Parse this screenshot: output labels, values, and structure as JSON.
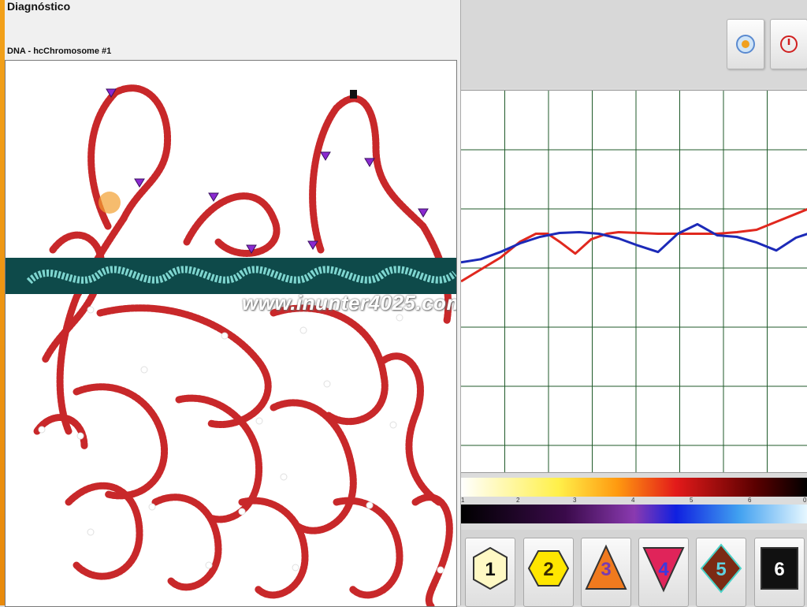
{
  "window": {
    "title": "Diagnóstico",
    "subtitle": "DNA - hcChromosome #1"
  },
  "watermark": "www.inunter4025.com",
  "toolbar": {
    "buttons": [
      {
        "name": "record-button",
        "icon": "record-icon"
      },
      {
        "name": "power-button",
        "icon": "power-icon"
      }
    ]
  },
  "colors": {
    "red_curve": "#e0281e",
    "blue_curve": "#1c2ab8",
    "grid": "#1f5a2a",
    "band": "#0e4a4a"
  },
  "chart_data": {
    "type": "line",
    "xlim": [
      0,
      440
    ],
    "ylim": [
      0,
      480
    ],
    "grid": true,
    "series": [
      {
        "x": [
          0,
          25,
          50,
          75,
          95,
          110,
          125,
          145,
          165,
          185,
          200,
          225,
          250,
          275,
          300,
          325,
          350,
          375,
          400,
          425,
          440
        ],
        "y": [
          240,
          255,
          270,
          290,
          300,
          300,
          290,
          275,
          293,
          300,
          302,
          301,
          300,
          300,
          300,
          300,
          302,
          305,
          315,
          325,
          331
        ]
      },
      {
        "x": [
          0,
          25,
          50,
          75,
          100,
          125,
          150,
          175,
          200,
          225,
          250,
          275,
          300,
          325,
          350,
          375,
          400,
          425,
          440
        ],
        "y": [
          264,
          268,
          277,
          288,
          296,
          301,
          302,
          300,
          294,
          285,
          277,
          300,
          312,
          298,
          296,
          289,
          279,
          295,
          300
        ]
      }
    ]
  },
  "scale": {
    "labels": [
      "1",
      "2",
      "3",
      "4",
      "5",
      "6",
      "0"
    ]
  },
  "levels": [
    {
      "label": "1",
      "shape": "hexagon",
      "fill": "#fff9c4",
      "text": "#111"
    },
    {
      "label": "2",
      "shape": "hexagon",
      "fill": "#ffe600",
      "text": "#3a2a00"
    },
    {
      "label": "3",
      "shape": "triangle-up",
      "fill": "#f07a1e",
      "text": "#7a3bb0"
    },
    {
      "label": "4",
      "shape": "triangle-down",
      "fill": "#e0245a",
      "text": "#3a3adf"
    },
    {
      "label": "5",
      "shape": "diamond",
      "fill": "#7b2a14",
      "text": "#5fd1e0"
    },
    {
      "label": "6",
      "shape": "square",
      "fill": "#111111",
      "text": "#ffffff"
    }
  ]
}
